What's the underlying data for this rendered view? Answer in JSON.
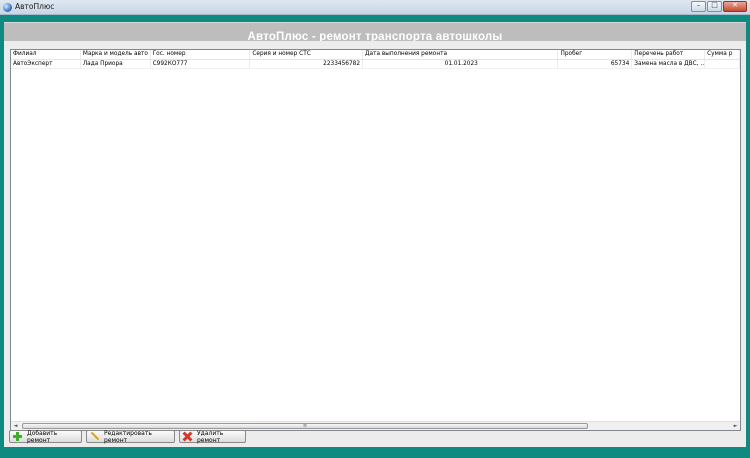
{
  "window": {
    "title": "АвтоПлюс",
    "controls": {
      "minimize": "–",
      "maximize": "□",
      "close": "✕"
    }
  },
  "header": {
    "title": "АвтоПлюс - ремонт транспорта автошколы"
  },
  "table": {
    "columns": [
      "Филиал",
      "Марка и модель авто",
      "Гос. номер",
      "Серия и номер СТС",
      "Дата выполнения ремонта",
      "Пробег",
      "Перечень работ",
      "Сумма р"
    ],
    "rows": [
      {
        "branch": "АвтоЭксперт",
        "model": "Лада Приора",
        "plate": "С992КО777",
        "sts": "2233456782",
        "date": "01.01.2023",
        "mileage": "65734",
        "works": "Замена масла в ДВС, ..."
      }
    ]
  },
  "scrollbar": {
    "left_arrow": "◄",
    "right_arrow": "►",
    "grip": "≡"
  },
  "buttons": {
    "add": "Добавить ремонт",
    "edit": "Редактировать ремонт",
    "delete": "Удалить ремонт"
  },
  "icons": {
    "app": "app-logo-icon",
    "add": "plus-icon",
    "edit": "pencil-icon",
    "delete": "x-icon"
  },
  "colors": {
    "frame": "#0f8a80",
    "header_band": "#bdbdbd",
    "header_text": "#ffffff"
  }
}
